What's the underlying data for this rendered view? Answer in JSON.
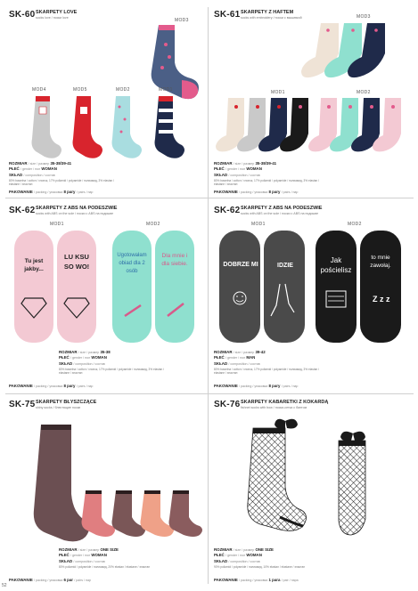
{
  "page_number": "52",
  "products": [
    {
      "code": "SK-60",
      "title": "SKARPETY LOVE",
      "subtitle": "socks love / носки love",
      "models": [
        "MOD3",
        "MOD4",
        "MOD5",
        "MOD2",
        "MOD1"
      ],
      "size_label": "ROZMIAR",
      "size_sub": "/ size / размер",
      "size": "35-38/39-41",
      "sex_label": "PŁEĆ",
      "sex_sub": "/ gender / пол",
      "sex": "WOMAN",
      "comp_label": "SKŁAD",
      "comp_sub": "/ composition / состав",
      "composition": "80% bawełna / cotton / хлопок, 17% poliamid / polyamide / полиамид, 3% elastan / elastane / эластан",
      "pack_label": "PAKOWANIE",
      "pack_sub": "/ packing / упаковка",
      "pack_count": "8 pary",
      "pack_tail": "/ pairs / пар"
    },
    {
      "code": "SK-61",
      "title": "SKARPETY Z HAFTEM",
      "subtitle": "socks with embroidery / носки с вышивкой",
      "models": [
        "MOD3",
        "MOD1",
        "MOD2"
      ],
      "size_label": "ROZMIAR",
      "size_sub": "/ size / размер",
      "size": "35-38/39-41",
      "sex_label": "PŁEĆ",
      "sex_sub": "/ gender / пол",
      "sex": "WOMAN",
      "comp_label": "SKŁAD",
      "comp_sub": "/ composition / состав",
      "composition": "80% bawełna / cotton / хлопок, 17% poliamid / polyamide / полиамид, 3% elastan / elastane / эластан",
      "pack_label": "PAKOWANIE",
      "pack_sub": "/ packing / упаковка",
      "pack_count": "8 pary",
      "pack_tail": "/ pairs / пар"
    },
    {
      "code": "SK-62",
      "title": "SKARPETY Z ABS NA PODESZWIE",
      "subtitle": "socks with ABS on the sole / носки с ABS на подошве",
      "models": [
        "MOD1",
        "MOD2"
      ],
      "sock_texts": [
        "Tu jest jakby...",
        "LU KSU SO WO!",
        "Ugotowałam obiad dla 2 osób",
        "Dla mnie i dla siebie."
      ],
      "size_label": "ROZMIAR",
      "size_sub": "/ size / размер",
      "size": "35-38",
      "sex_label": "PŁEĆ",
      "sex_sub": "/ gender / пол",
      "sex": "WOMAN",
      "comp_label": "SKŁAD",
      "comp_sub": "/ composition / состав",
      "composition": "80% bawełna / cotton / хлопок, 17% poliamid / polyamide / полиамид, 3% elastan / elastane / эластан",
      "pack_label": "PAKOWANIE",
      "pack_sub": "/ packing / упаковка",
      "pack_count": "8 pary",
      "pack_tail": "/ pairs / пар"
    },
    {
      "code": "SK-62",
      "title": "SKARPETY Z ABS NA PODESZWIE",
      "subtitle": "socks with ABS on the sole / носки с ABS на подошве",
      "models": [
        "MOD1",
        "MOD2"
      ],
      "sock_texts": [
        "DOBRZE MI",
        "IDZIE",
        "Jak pościelisz",
        "to mnie zawołaj."
      ],
      "size_label": "ROZMIAR",
      "size_sub": "/ size / размер",
      "size": "39-42",
      "sex_label": "PŁEĆ",
      "sex_sub": "/ gender / пол",
      "sex": "MAN",
      "comp_label": "SKŁAD",
      "comp_sub": "/ composition / состав",
      "composition": "80% bawełna / cotton / хлопок, 17% poliamid / polyamide / полиамид, 3% elastan / elastane / эластан",
      "pack_label": "PAKOWANIE",
      "pack_sub": "/ packing / упаковка",
      "pack_count": "8 pary",
      "pack_tail": "/ pairs / пар"
    },
    {
      "code": "SK-75",
      "title": "SKARPETY BŁYSZCZĄCE",
      "subtitle": "shiny socks / блестящие носки",
      "size_label": "ROZMIAR",
      "size_sub": "/ size / размер",
      "size": "ONE SIZE",
      "sex_label": "PŁEĆ",
      "sex_sub": "/ gender / пол",
      "sex": "WOMAN",
      "comp_label": "SKŁAD",
      "comp_sub": "/ composition / состав",
      "composition": "80% poliamid / polyamide / полиамид, 20% elastan / elastane / эластан",
      "pack_label": "PAKOWANIE",
      "pack_sub": "/ packing / упаковка",
      "pack_count": "6 par",
      "pack_tail": "/ pairs / пар"
    },
    {
      "code": "SK-76",
      "title": "SKARPETY KABARETKI Z KOKARDĄ",
      "subtitle": "fishnet socks with bow / носки-сетка с бантом",
      "size_label": "ROZMIAR",
      "size_sub": "/ size / размер",
      "size": "ONE SIZE",
      "sex_label": "PŁEĆ",
      "sex_sub": "/ gender / пол",
      "sex": "WOMAN",
      "comp_label": "SKŁAD",
      "comp_sub": "/ composition / состав",
      "composition": "90% poliamid / polyamide / полиамид, 10% elastan / elastane / эластан",
      "pack_label": "PAKOWANIE",
      "pack_sub": "/ packing / упаковка",
      "pack_count": "1 para",
      "pack_tail": "/ pair / пара"
    }
  ],
  "colors": {
    "code_text": "#222222",
    "pink_sock": "#f3c9d3",
    "mint_sock": "#8fe0cf",
    "navy_sock": "#1f2a4a",
    "red_sock": "#d8242d",
    "grey_sock": "#c9c9c9",
    "cream_sock": "#efe3d6",
    "charcoal_sock": "#4a4a4a",
    "black_sock": "#1a1a1a"
  }
}
